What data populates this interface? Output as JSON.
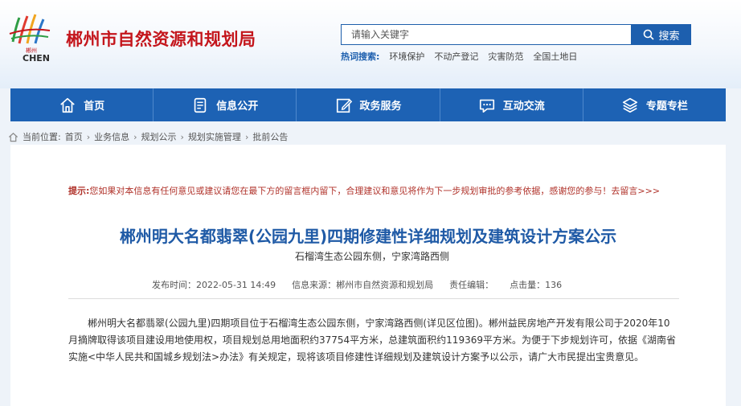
{
  "header": {
    "logo_sub": "郴州",
    "logo_text": "CHEN",
    "site_title": "郴州市自然资源和规划局",
    "search": {
      "placeholder": "请输入关键字",
      "button_label": "搜索"
    },
    "hot_search": {
      "label": "热词搜索:",
      "keywords": [
        "环境保护",
        "不动产登记",
        "灾害防范",
        "全国土地日"
      ]
    },
    "brand_color": "#c4161c",
    "accent_color": "#1d62b4"
  },
  "nav": {
    "items": [
      {
        "label": "首页",
        "icon": "home-icon"
      },
      {
        "label": "信息公开",
        "icon": "document-icon"
      },
      {
        "label": "政务服务",
        "icon": "edit-icon"
      },
      {
        "label": "互动交流",
        "icon": "chat-icon"
      },
      {
        "label": "专题专栏",
        "icon": "layers-icon"
      }
    ]
  },
  "breadcrumb": {
    "prefix": "当前位置:",
    "items": [
      "首页",
      "业务信息",
      "规划公示",
      "规划实施管理",
      "批前公告"
    ]
  },
  "article": {
    "tip_label": "提示:",
    "tip_text": "您如果对本信息有任何意见或建议请您在最下方的留言框内留下，合理建议和意见将作为下一步规划审批的参考依据，感谢您的参与！去留言>>>",
    "title": "郴州明大名都翡翠(公园九里)四期修建性详细规划及建筑设计方案公示",
    "subtitle": "石榴湾生态公园东侧，宁家湾路西侧",
    "meta": {
      "publish_time": "发布时间：2022-05-31 14:49",
      "source": "信息来源：郴州市自然资源和规划局",
      "editor": "责任编辑：",
      "hits": "点击量：136"
    },
    "body": "郴州明大名都翡翠(公园九里)四期项目位于石榴湾生态公园东侧，宁家湾路西侧(详见区位图)。郴州益民房地产开发有限公司于2020年10月摘牌取得该项目建设用地使用权，项目规划总用地面积约37754平方米，总建筑面积约119369平方米。为便于下步规划许可，依据《湖南省实施<中华人民共和国城乡规划法>办法》有关规定，现将该项目修建性详细规划及建筑设计方案予以公示，请广大市民提出宝贵意见。"
  }
}
